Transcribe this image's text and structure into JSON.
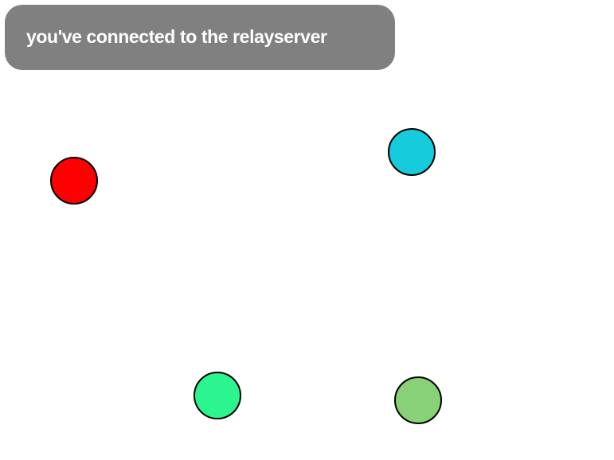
{
  "status": {
    "message": "you've connected to the relayserver",
    "background": "#808080",
    "text_color": "#ffffff"
  },
  "players": [
    {
      "id": "red",
      "color": "#ff0000"
    },
    {
      "id": "cyan",
      "color": "#16cbdc"
    },
    {
      "id": "mint",
      "color": "#2cf58f"
    },
    {
      "id": "lime",
      "color": "#88d176"
    }
  ]
}
